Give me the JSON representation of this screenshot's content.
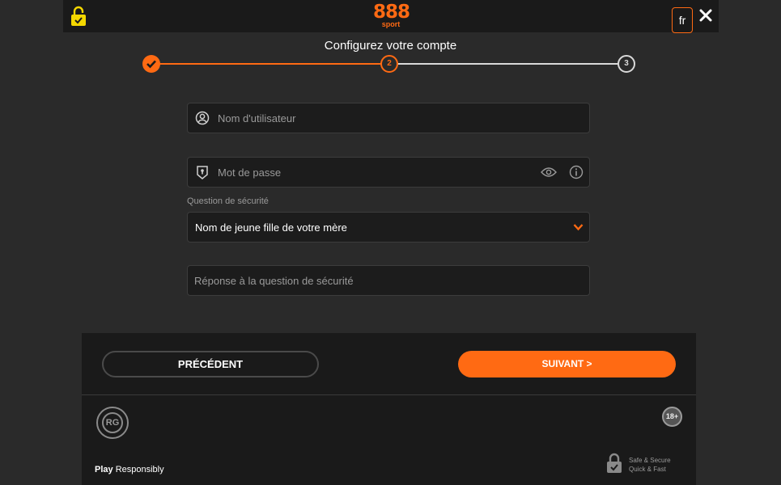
{
  "header": {
    "logo_main": "888",
    "logo_sub": "sport",
    "lang": "fr"
  },
  "stepper": {
    "title": "Configurez votre compte",
    "step2": "2",
    "step3": "3"
  },
  "form": {
    "username_placeholder": "Nom d'utilisateur",
    "password_placeholder": "Mot de passe",
    "security_label": "Question de sécurité",
    "security_value": "Nom de jeune fille de votre mère",
    "answer_placeholder": "Réponse à la question de sécurité"
  },
  "footer": {
    "prev_label": "PRÉCÉDENT",
    "next_label": "SUIVANT >",
    "rg_label": "RG",
    "age_label": "18+",
    "play_label": "Play",
    "responsibly_label": " Responsibly",
    "secure_line1": "Safe & Secure",
    "secure_line2": "Quick & Fast"
  },
  "colors": {
    "accent": "#ff6a13",
    "background": "#2a2a2a",
    "panel": "#1a1a1a",
    "lock_yellow": "#f5d800"
  }
}
